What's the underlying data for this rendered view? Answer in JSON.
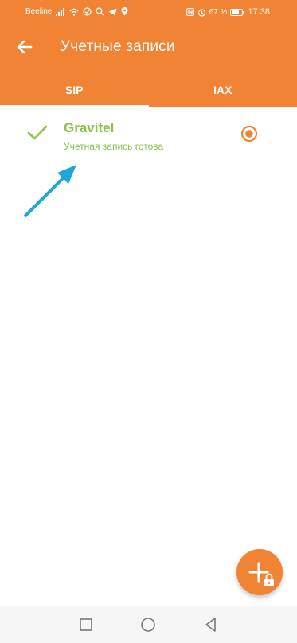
{
  "status_bar": {
    "carrier": "Beeline",
    "battery": "67 %",
    "time": "17:38"
  },
  "app_bar": {
    "title": "Учетные записи",
    "back_icon": "arrow-left-icon"
  },
  "tabs": [
    {
      "label": "SIP",
      "selected": true
    },
    {
      "label": "IAX",
      "selected": false
    }
  ],
  "accounts": [
    {
      "name": "Gravitel",
      "status": "Учетная запись готова",
      "selected": true,
      "status_icon": "check-icon"
    }
  ],
  "fab": {
    "icon": "add-locked-icon"
  },
  "nav_bar": {
    "icons": [
      "recent-apps-icon",
      "home-icon",
      "back-icon"
    ]
  },
  "colors": {
    "primary": "#f08434",
    "success": "#8bc34a",
    "annotation": "#1ba7d8"
  }
}
